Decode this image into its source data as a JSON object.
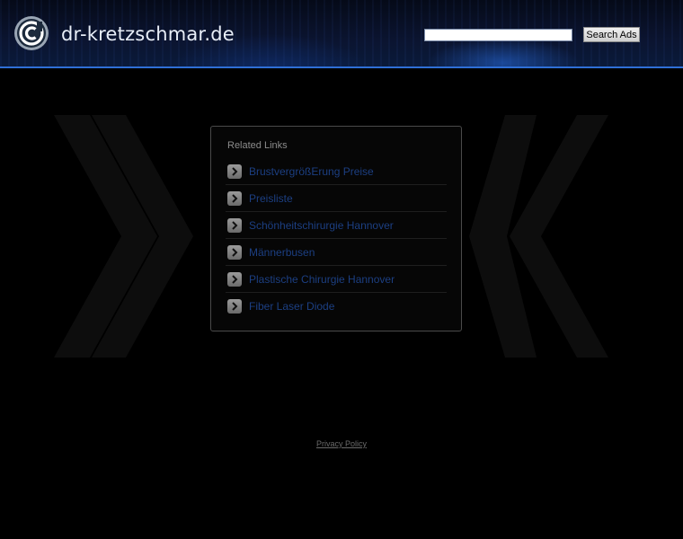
{
  "header": {
    "site_title": "dr-kretzschmar.de",
    "logo_icon": "circle-target-logo-icon",
    "search": {
      "value": "",
      "button_label": "Search Ads"
    },
    "accent_color": "#2f6fd6"
  },
  "related_links": {
    "title": "Related Links",
    "icon": "chevron-right-icon",
    "link_color": "#1c3f82",
    "items": [
      {
        "label": "BrustvergrößErung Preise"
      },
      {
        "label": "Preisliste"
      },
      {
        "label": "Schönheitschirurgie Hannover"
      },
      {
        "label": "Männerbusen"
      },
      {
        "label": "Plastische Chirurgie Hannover"
      },
      {
        "label": "Fiber Laser Diode"
      }
    ]
  },
  "footer": {
    "privacy_label": "Privacy Policy"
  }
}
